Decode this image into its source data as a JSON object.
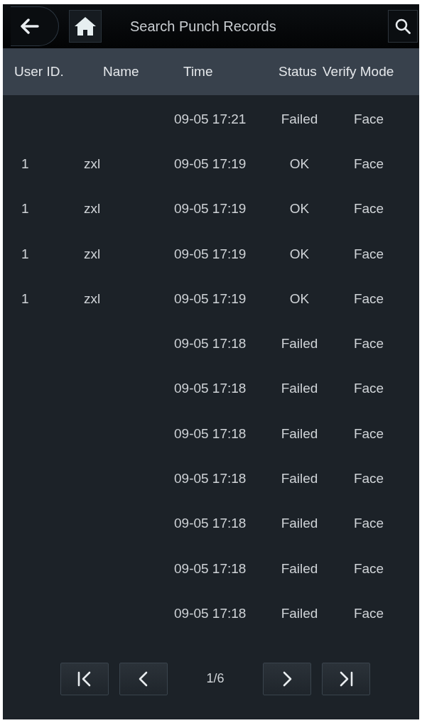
{
  "top_bar": {
    "title": "Search Punch Records"
  },
  "table": {
    "columns": [
      "User ID.",
      "Name",
      "Time",
      "Status",
      "Verify Mode"
    ],
    "rows": [
      {
        "time": "09-05 17:21",
        "status": "Failed",
        "verify_mode": "Face"
      },
      {
        "user_id": "1",
        "name": "zxl",
        "time": "09-05 17:19",
        "status": "OK",
        "verify_mode": "Face"
      },
      {
        "user_id": "1",
        "name": "zxl",
        "time": "09-05 17:19",
        "status": "OK",
        "verify_mode": "Face"
      },
      {
        "user_id": "1",
        "name": "zxl",
        "time": "09-05 17:19",
        "status": "OK",
        "verify_mode": "Face"
      },
      {
        "user_id": "1",
        "name": "zxl",
        "time": "09-05 17:19",
        "status": "OK",
        "verify_mode": "Face"
      },
      {
        "time": "09-05 17:18",
        "status": "Failed",
        "verify_mode": "Face"
      },
      {
        "time": "09-05 17:18",
        "status": "Failed",
        "verify_mode": "Face"
      },
      {
        "time": "09-05 17:18",
        "status": "Failed",
        "verify_mode": "Face"
      },
      {
        "time": "09-05 17:18",
        "status": "Failed",
        "verify_mode": "Face"
      },
      {
        "time": "09-05 17:18",
        "status": "Failed",
        "verify_mode": "Face"
      },
      {
        "time": "09-05 17:18",
        "status": "Failed",
        "verify_mode": "Face"
      },
      {
        "time": "09-05 17:18",
        "status": "Failed",
        "verify_mode": "Face"
      }
    ]
  },
  "pagination": {
    "page": "1/6"
  }
}
